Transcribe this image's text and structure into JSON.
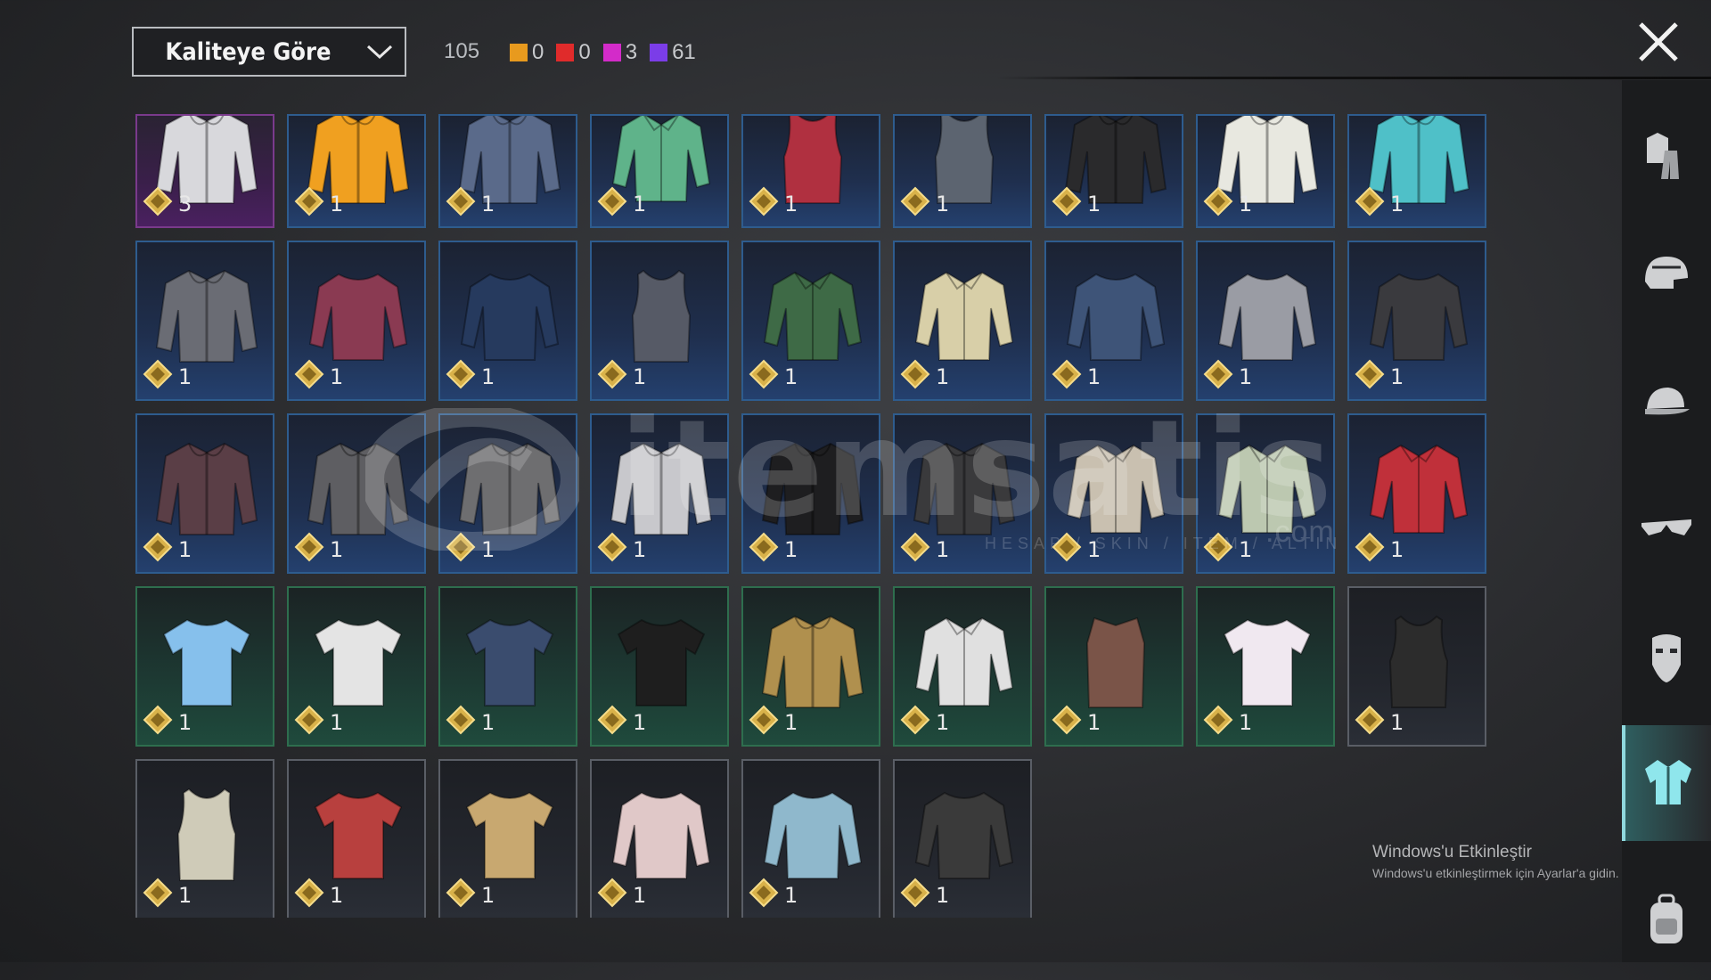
{
  "header": {
    "sort_label": "Kaliteye Göre",
    "total": "105",
    "quality_counts": [
      {
        "color": "#e89a1e",
        "value": "0",
        "name": "legendary"
      },
      {
        "color": "#e02b2b",
        "value": "0",
        "name": "mythic"
      },
      {
        "color": "#d32bc9",
        "value": "3",
        "name": "epic"
      },
      {
        "color": "#7b3de8",
        "value": "61",
        "name": "rare"
      }
    ]
  },
  "sidebar": {
    "items": [
      {
        "icon": "outfit-icon"
      },
      {
        "icon": "helmet-icon"
      },
      {
        "icon": "cap-icon"
      },
      {
        "icon": "sunglasses-icon"
      },
      {
        "icon": "mask-icon"
      },
      {
        "icon": "shirt-icon",
        "active": true
      },
      {
        "icon": "backpack-icon"
      }
    ]
  },
  "items": [
    {
      "q": "purple",
      "c": "#d8d8dc",
      "k": "jacket",
      "n": "3"
    },
    {
      "q": "blue",
      "c": "#f0a020",
      "k": "jacket",
      "n": "1"
    },
    {
      "q": "blue",
      "c": "#5a6a8a",
      "k": "jacket",
      "n": "1"
    },
    {
      "q": "blue",
      "c": "#5fb38a",
      "k": "shirt",
      "n": "1"
    },
    {
      "q": "blue",
      "c": "#b03040",
      "k": "tank",
      "n": "1"
    },
    {
      "q": "blue",
      "c": "#5c6470",
      "k": "tank",
      "n": "1"
    },
    {
      "q": "blue",
      "c": "#2a2a2c",
      "k": "jacket",
      "n": "1"
    },
    {
      "q": "blue",
      "c": "#e8e8e0",
      "k": "jacket",
      "n": "1"
    },
    {
      "q": "blue",
      "c": "#4fc0c8",
      "k": "jacket",
      "n": "1"
    },
    {
      "q": "blue",
      "c": "#6a6c74",
      "k": "jacket",
      "n": "1"
    },
    {
      "q": "blue",
      "c": "#8a3a52",
      "k": "longsleeve",
      "n": "1"
    },
    {
      "q": "blue",
      "c": "#263a5e",
      "k": "longsleeve",
      "n": "1"
    },
    {
      "q": "blue",
      "c": "#565a66",
      "k": "tank",
      "n": "1"
    },
    {
      "q": "blue",
      "c": "#3e6a46",
      "k": "shirt",
      "n": "1"
    },
    {
      "q": "blue",
      "c": "#d8cfa8",
      "k": "shirt",
      "n": "1"
    },
    {
      "q": "blue",
      "c": "#3e5478",
      "k": "longsleeve",
      "n": "1"
    },
    {
      "q": "blue",
      "c": "#9a9ca4",
      "k": "longsleeve",
      "n": "1"
    },
    {
      "q": "blue",
      "c": "#3a3a3e",
      "k": "longsleeve",
      "n": "1"
    },
    {
      "q": "blue",
      "c": "#5a3e46",
      "k": "jacket",
      "n": "1"
    },
    {
      "q": "blue",
      "c": "#5e5e62",
      "k": "jacket",
      "n": "1"
    },
    {
      "q": "blue",
      "c": "#6e6e70",
      "k": "jacket",
      "n": "1"
    },
    {
      "q": "blue",
      "c": "#c8c8cc",
      "k": "jacket",
      "n": "1"
    },
    {
      "q": "blue",
      "c": "#1e1e20",
      "k": "jacket",
      "n": "1"
    },
    {
      "q": "blue",
      "c": "#3a3a3c",
      "k": "jacket",
      "n": "1"
    },
    {
      "q": "blue",
      "c": "#c9c0b0",
      "k": "shirt",
      "n": "1"
    },
    {
      "q": "blue",
      "c": "#bcc8b0",
      "k": "shirt",
      "n": "1"
    },
    {
      "q": "blue",
      "c": "#c0303a",
      "k": "shirt",
      "n": "1"
    },
    {
      "q": "green",
      "c": "#86c0ec",
      "k": "tee",
      "n": "1"
    },
    {
      "q": "green",
      "c": "#e4e4e4",
      "k": "tee",
      "n": "1"
    },
    {
      "q": "green",
      "c": "#3a4c6e",
      "k": "tee",
      "n": "1"
    },
    {
      "q": "green",
      "c": "#1e1e1e",
      "k": "tee",
      "n": "1"
    },
    {
      "q": "green",
      "c": "#b0904e",
      "k": "jacket",
      "n": "1"
    },
    {
      "q": "green",
      "c": "#e0e0e0",
      "k": "shirt",
      "n": "1"
    },
    {
      "q": "green",
      "c": "#7a5448",
      "k": "vest",
      "n": "1"
    },
    {
      "q": "green",
      "c": "#f0e8f0",
      "k": "tee",
      "n": "1"
    },
    {
      "q": "gray",
      "c": "#2c2c2c",
      "k": "tank",
      "n": "1"
    },
    {
      "q": "gray",
      "c": "#cfcbb8",
      "k": "tank",
      "n": "1"
    },
    {
      "q": "gray",
      "c": "#b8403e",
      "k": "tee",
      "n": "1"
    },
    {
      "q": "gray",
      "c": "#c8a870",
      "k": "tee",
      "n": "1"
    },
    {
      "q": "gray",
      "c": "#e0c8c8",
      "k": "longsleeve",
      "n": "1"
    },
    {
      "q": "gray",
      "c": "#8fb8cc",
      "k": "longsleeve",
      "n": "1"
    },
    {
      "q": "gray",
      "c": "#3a3a3a",
      "k": "longsleeve",
      "n": "1"
    }
  ],
  "watermark": {
    "brand": "itemsatis",
    "domain": ".com",
    "tagline": "HESAP / SKIN / ITEM / ALTIN"
  },
  "activation": {
    "title": "Windows'u Etkinleştir",
    "subtitle": "Windows'u etkinleştirmek için Ayarlar'a gidin."
  }
}
